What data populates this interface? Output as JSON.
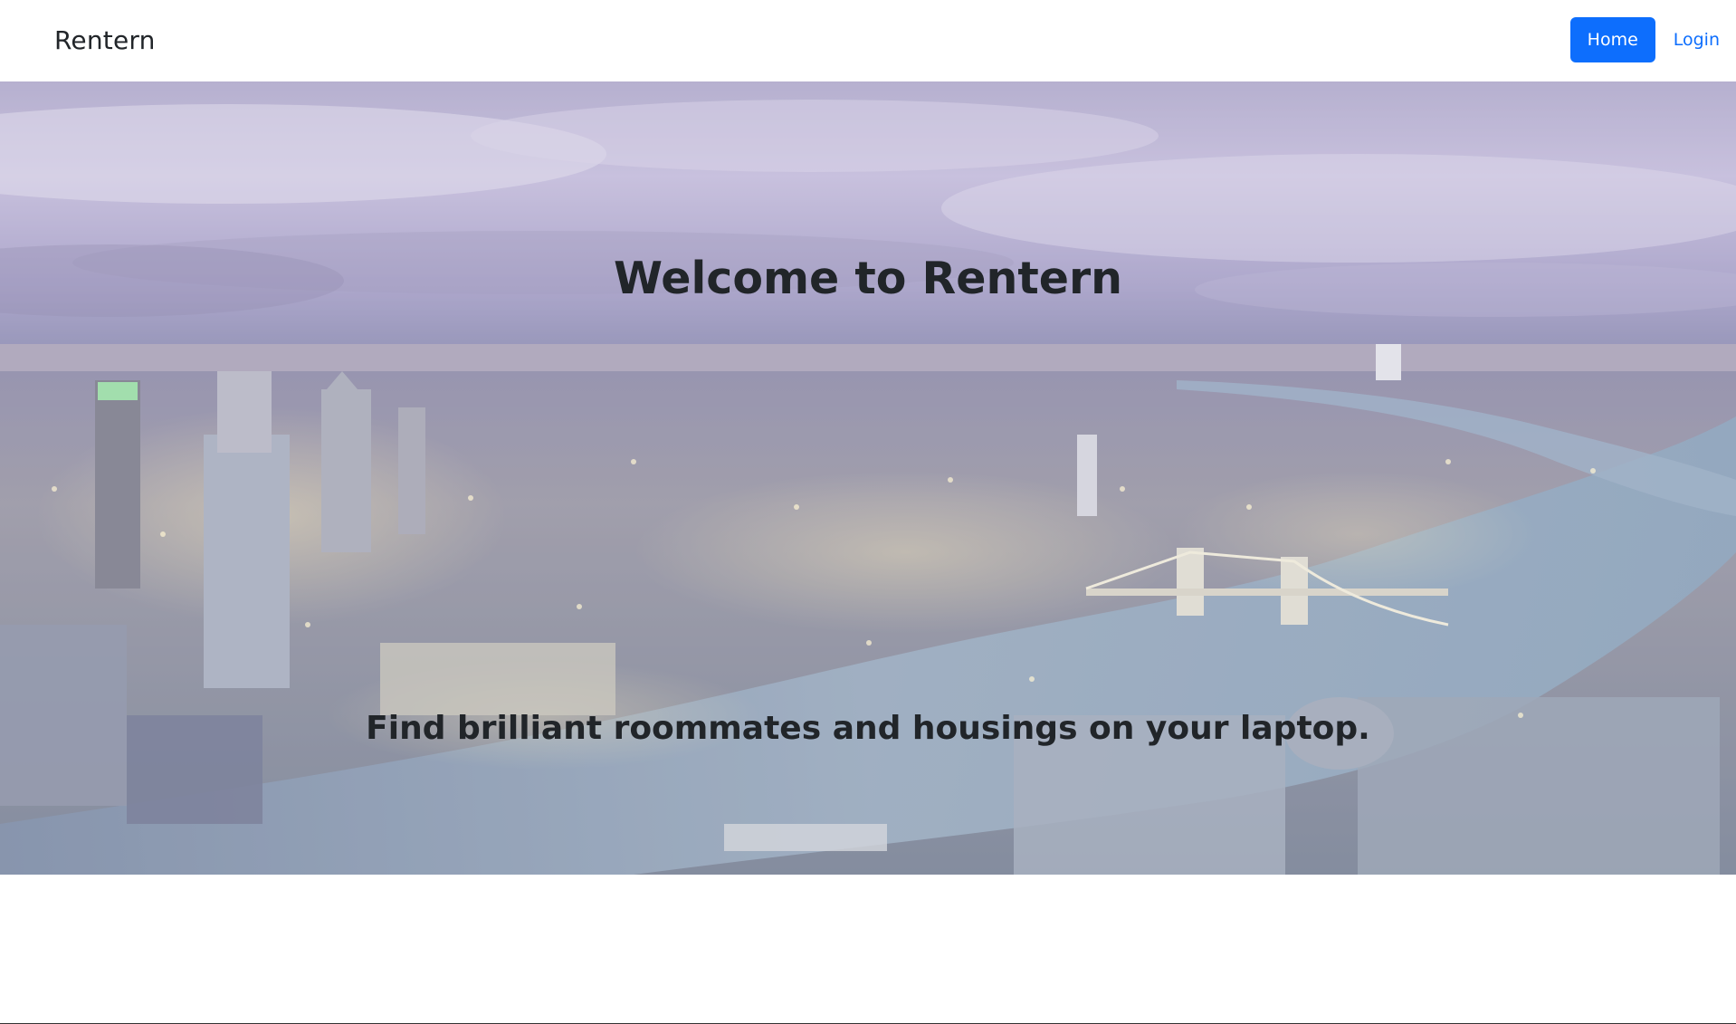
{
  "navbar": {
    "brand": "Rentern",
    "links": [
      {
        "label": "Home",
        "active": true
      },
      {
        "label": "Login",
        "active": false
      }
    ]
  },
  "hero": {
    "title": "Welcome to Rentern",
    "subtitle": "Find brilliant roommates and housings on your laptop.",
    "background": "city-skyline-photo"
  },
  "colors": {
    "primary": "#0d6efd",
    "text": "#212529",
    "background": "#ffffff"
  }
}
